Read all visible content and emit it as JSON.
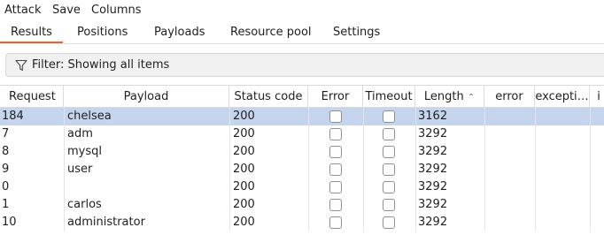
{
  "menu": [
    "Attack",
    "Save",
    "Columns"
  ],
  "tabs": [
    "Results",
    "Positions",
    "Payloads",
    "Resource pool",
    "Settings"
  ],
  "active_tab": "Results",
  "filter": {
    "label": "Filter: Showing all items",
    "icon": "filter-funnel-icon"
  },
  "table": {
    "columns": [
      "Request",
      "Payload",
      "Status code",
      "Error",
      "Timeout",
      "Length",
      "error",
      "excepti…",
      "i"
    ],
    "sort_column": "Length",
    "sort_direction": "ascending",
    "rows": [
      {
        "request": "184",
        "payload": "chelsea",
        "status": "200",
        "error": false,
        "timeout": false,
        "length": "3162",
        "selected": true
      },
      {
        "request": "7",
        "payload": "adm",
        "status": "200",
        "error": false,
        "timeout": false,
        "length": "3292",
        "selected": false
      },
      {
        "request": "8",
        "payload": "mysql",
        "status": "200",
        "error": false,
        "timeout": false,
        "length": "3292",
        "selected": false
      },
      {
        "request": "9",
        "payload": "user",
        "status": "200",
        "error": false,
        "timeout": false,
        "length": "3292",
        "selected": false
      },
      {
        "request": "0",
        "payload": "",
        "status": "200",
        "error": false,
        "timeout": false,
        "length": "3292",
        "selected": false
      },
      {
        "request": "1",
        "payload": "carlos",
        "status": "200",
        "error": false,
        "timeout": false,
        "length": "3292",
        "selected": false
      },
      {
        "request": "10",
        "payload": "administrator",
        "status": "200",
        "error": false,
        "timeout": false,
        "length": "3292",
        "selected": false
      }
    ]
  },
  "colors": {
    "accent": "#e8622c",
    "selected_row": "#c5d5ee"
  }
}
